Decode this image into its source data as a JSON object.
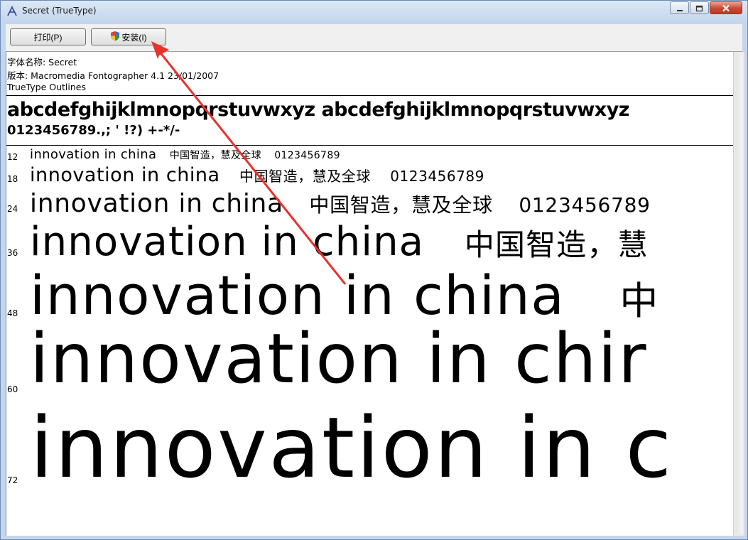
{
  "window": {
    "title": "Secret (TrueType)",
    "app_icon": "font-viewer-icon"
  },
  "toolbar": {
    "print_label": "打印(P)",
    "install_label": "安装(I)"
  },
  "info": {
    "font_name": "字体名称: Secret",
    "version": "版本: Macromedia Fontographer 4.1 23/01/2007",
    "outlines": "TrueType Outlines"
  },
  "charset": {
    "line1": "abcdefghijklmnopqrstuvwxyz  abcdefghijklmnopqrstuvwxyz",
    "line2": "0123456789.,;  '      !?)    +-*/-"
  },
  "samples": [
    {
      "size": "12",
      "latin": "innovation in china",
      "cjk": "中国智造，慧及全球",
      "digits": "0123456789"
    },
    {
      "size": "18",
      "latin": "innovation in china",
      "cjk": "中国智造，慧及全球",
      "digits": "0123456789"
    },
    {
      "size": "24",
      "latin": "innovation in china",
      "cjk": "中国智造，慧及全球",
      "digits": "0123456789"
    },
    {
      "size": "36",
      "latin": "innovation in china",
      "cjk": "中国智造，慧",
      "digits": ""
    },
    {
      "size": "48",
      "latin": "innovation in china",
      "cjk": "中",
      "digits": ""
    },
    {
      "size": "60",
      "latin": "innovation in chir",
      "cjk": "",
      "digits": ""
    },
    {
      "size": "72",
      "latin": "innovation in c",
      "cjk": "",
      "digits": ""
    }
  ],
  "colors": {
    "annotation_arrow": "#e8322c"
  }
}
